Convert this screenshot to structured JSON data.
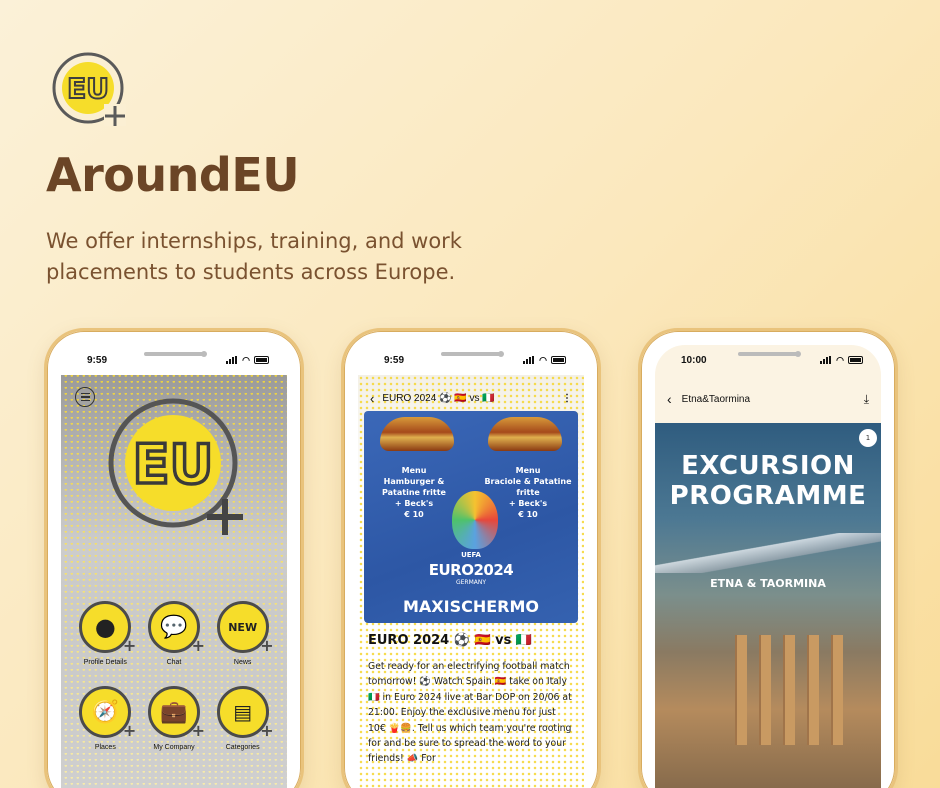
{
  "brand": {
    "logo_text": "EU",
    "title": "AroundEU",
    "tagline": "We offer internships, training, and work placements to students across Europe."
  },
  "colors": {
    "brand_brown": "#6b4526",
    "accent_yellow": "#f6dd2a",
    "poster_blue": "#2d57a5"
  },
  "phones": [
    {
      "time": "9:59",
      "icons": [
        {
          "label": "Profile Details",
          "icon": "profile-icon"
        },
        {
          "label": "Chat",
          "icon": "chat-icon"
        },
        {
          "label": "News",
          "icon": "new-badge-icon"
        },
        {
          "label": "Places",
          "icon": "compass-icon"
        },
        {
          "label": "My Company",
          "icon": "briefcase-icon"
        },
        {
          "label": "Categories",
          "icon": "documents-icon"
        }
      ],
      "new_badge": "NEW"
    },
    {
      "time": "9:59",
      "header": "EURO 2024 ⚽ 🇪🇸 vs 🇮🇹",
      "poster": {
        "menu_left": "Menu\nHamburger & Patatine fritte\n+ Beck's\n€ 10",
        "menu_right": "Menu\nBraciole & Patatine fritte\n+ Beck's\n€ 10",
        "uefa": "UEFA",
        "euro": "EURO2024",
        "germany": "GERMANY",
        "maxi": "MAXISCHERMO"
      },
      "title": "EURO 2024 ⚽ 🇪🇸 vs 🇮🇹",
      "body": "Get ready for an electrifying football match tomorrow! ⚽ Watch Spain 🇪🇸 take on Italy 🇮🇹 in Euro 2024 live at Bar DOP on 20/06 at 21:00. Enjoy the exclusive menu for just 10€ 🍟🍔. Tell us which team you're rooting for and be sure to spread the word to your friends! 📣 For"
    },
    {
      "time": "10:00",
      "header": "Etna&Taormina",
      "page_badge": "1",
      "poster_line1": "EXCURSION",
      "poster_line2": "PROGRAMME",
      "poster_sub": "ETNA & TAORMINA"
    }
  ]
}
